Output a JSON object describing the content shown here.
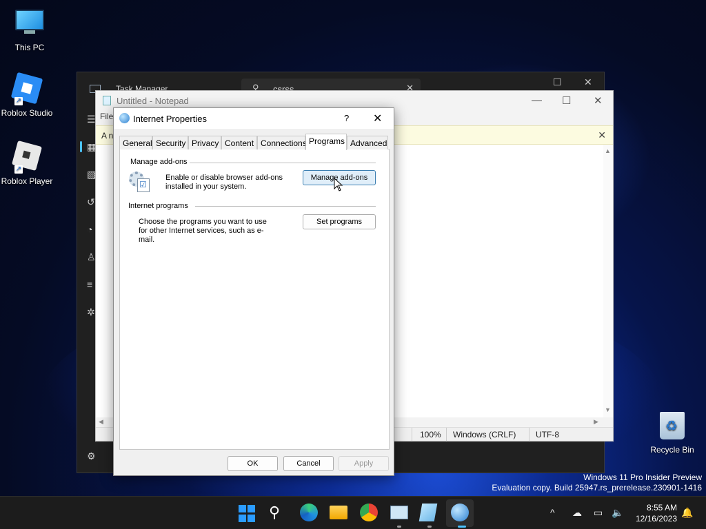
{
  "desktop": {
    "icons": [
      {
        "label": "This PC"
      },
      {
        "label": "Roblox Studio"
      },
      {
        "label": "Roblox Player"
      },
      {
        "label": "Recycle Bin"
      }
    ],
    "watermark": {
      "line1": "Windows 11 Pro Insider Preview",
      "line2": "Evaluation copy. Build 25947.rs_prerelease.230901-1416"
    }
  },
  "task_manager": {
    "title": "Task Manager",
    "search_value": "csrss"
  },
  "notepad": {
    "title": "Untitled - Notepad",
    "menu_file": "File",
    "banner_text": "A n",
    "status": {
      "zoom": "100%",
      "line_ending": "Windows (CRLF)",
      "encoding": "UTF-8"
    }
  },
  "dialog": {
    "title": "Internet Properties",
    "help": "?",
    "tabs": [
      {
        "label": "General"
      },
      {
        "label": "Security"
      },
      {
        "label": "Privacy"
      },
      {
        "label": "Content"
      },
      {
        "label": "Connections"
      },
      {
        "label": "Programs"
      },
      {
        "label": "Advanced"
      }
    ],
    "active_tab": "Programs",
    "manage_addons": {
      "group_label": "Manage add-ons",
      "description": "Enable or disable browser add-ons installed in your system.",
      "button": "Manage add-ons"
    },
    "internet_programs": {
      "group_label": "Internet programs",
      "description": "Choose the programs you want to use for other Internet services, such as e-mail.",
      "button": "Set programs"
    },
    "buttons": {
      "ok": "OK",
      "cancel": "Cancel",
      "apply": "Apply"
    }
  },
  "taskbar": {
    "clock_time": "8:55 AM",
    "clock_date": "12/16/2023",
    "apps": [
      "start-icon",
      "search-icon",
      "edge-beta-icon",
      "file-explorer-icon",
      "chrome-icon",
      "task-manager-icon",
      "notepad-icon",
      "internet-properties-icon"
    ]
  }
}
